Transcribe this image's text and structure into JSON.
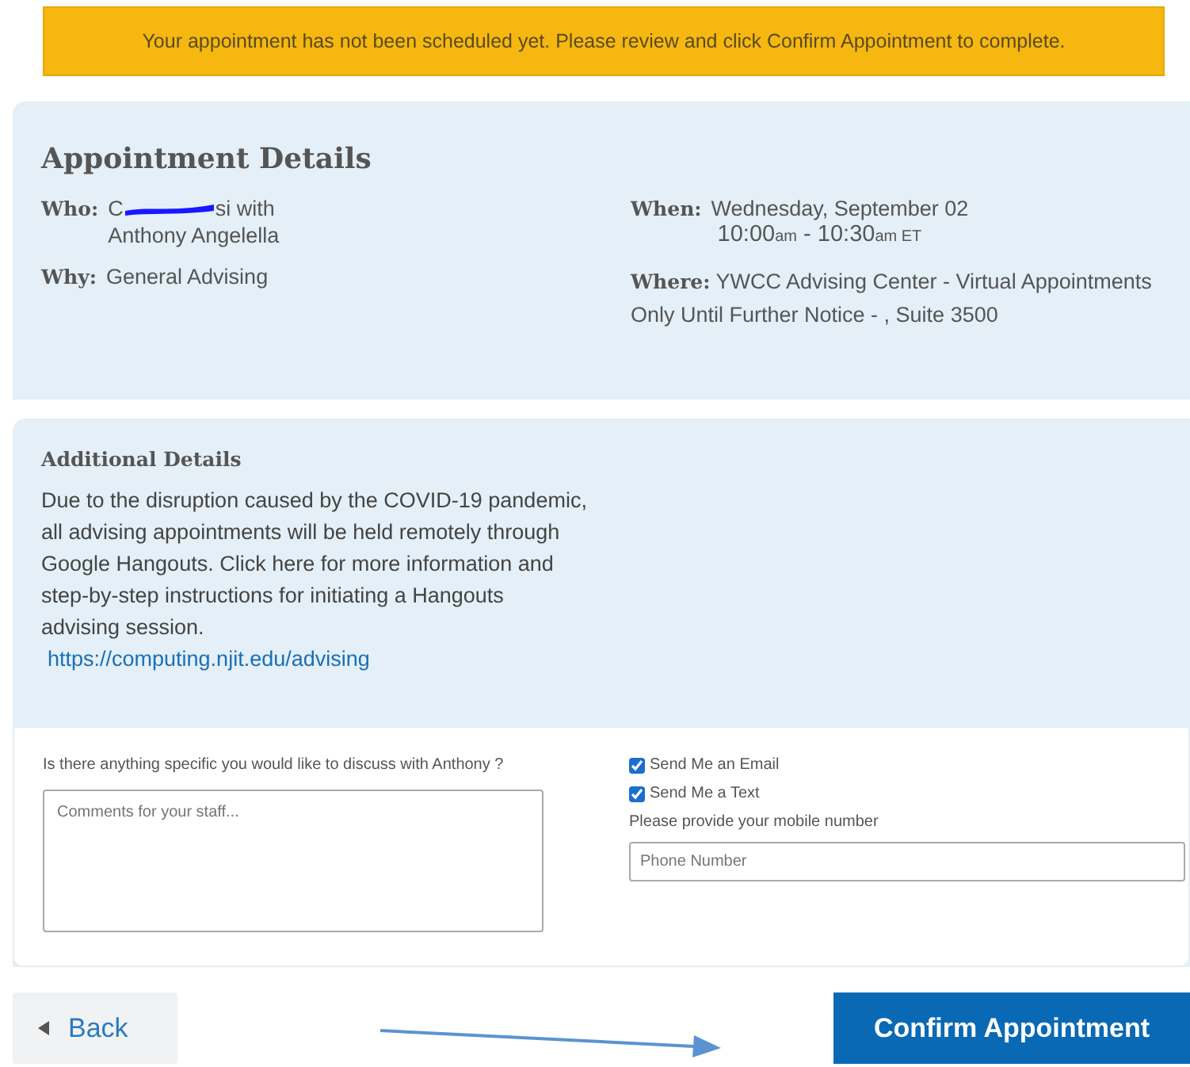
{
  "banner": {
    "text": "Your appointment has not been scheduled yet. Please review and click Confirm Appointment to complete."
  },
  "details": {
    "title": "Appointment Details",
    "who": {
      "label": "Who:",
      "before": "C",
      "redacted": true,
      "after": "si with",
      "line2": "Anthony Angelella"
    },
    "why": {
      "label": "Why:",
      "value": "General Advising"
    },
    "when": {
      "label": "When:",
      "date": "Wednesday, September 02",
      "start": "10:00",
      "start_suffix": "am",
      "sep": "-",
      "end": "10:30",
      "end_suffix": "am",
      "tz": "ET"
    },
    "where": {
      "label": "Where:",
      "value": "YWCC Advising Center - Virtual Appointments Only Until Further Notice - , Suite 3500"
    }
  },
  "additional": {
    "title": "Additional Details",
    "text": "Due to the disruption caused by the COVID-19 pandemic, all advising appointments will be held remotely through Google Hangouts. Click here for more information and step-by-step instructions for initiating a Hangouts advising session.",
    "link": "https://computing.njit.edu/advising"
  },
  "form": {
    "question": "Is there anything specific you would like to discuss with Anthony ?",
    "comments_placeholder": "Comments for your staff...",
    "options": [
      {
        "label": "Send Me an Email",
        "checked": true
      },
      {
        "label": "Send Me a Text",
        "checked": true
      }
    ],
    "phone_label": "Please provide your mobile number",
    "phone_placeholder": "Phone Number"
  },
  "buttons": {
    "back": "Back",
    "confirm": "Confirm Appointment"
  },
  "annotation_arrow": true
}
